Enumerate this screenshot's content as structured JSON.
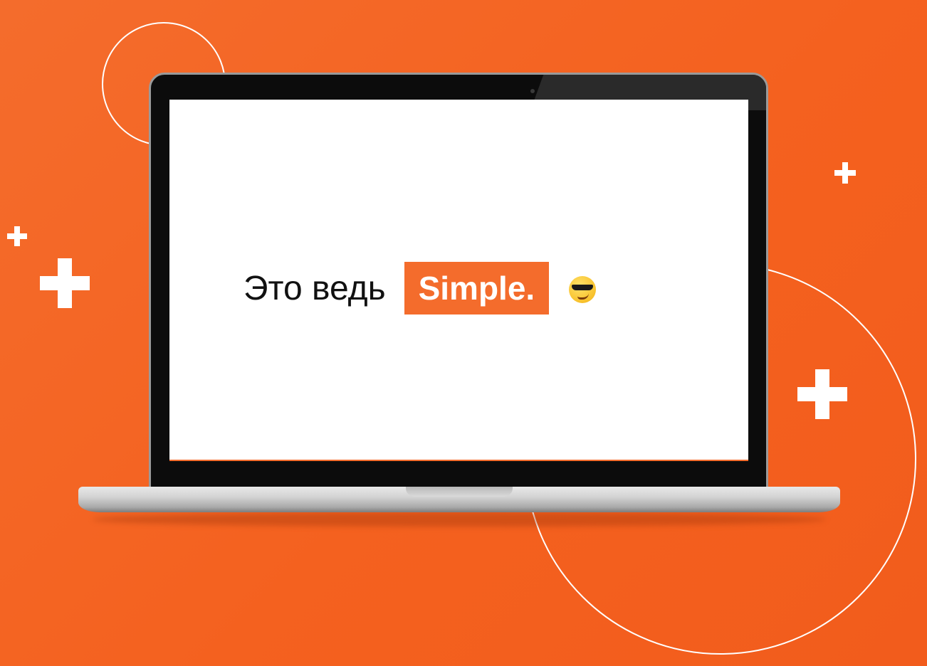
{
  "headline": {
    "lead_text": "Это ведь",
    "highlight_text": "Simple."
  },
  "colors": {
    "background": "#f46c2c",
    "accent": "#f46c2c",
    "screen": "#ffffff",
    "text": "#111111"
  },
  "icons": [
    "plus-icon",
    "sunglasses-emoji-icon",
    "laptop-illustration"
  ]
}
